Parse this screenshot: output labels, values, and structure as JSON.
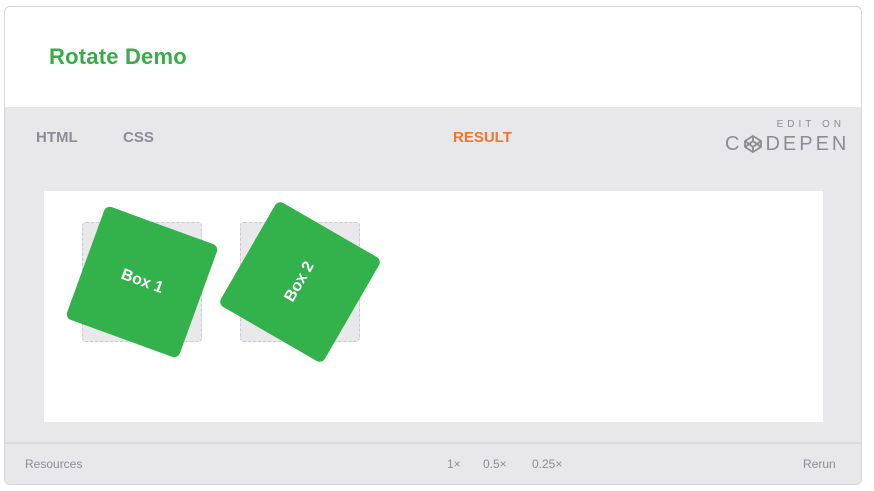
{
  "header": {
    "title": "Rotate Demo"
  },
  "tabs": [
    {
      "label": "HTML",
      "active": false
    },
    {
      "label": "CSS",
      "active": false
    },
    {
      "label": "RESULT",
      "active": true
    }
  ],
  "codepen": {
    "edit_on": "EDIT ON",
    "brand_left": "C",
    "brand_right": "DEPEN",
    "icon": "codepen-logo-icon"
  },
  "result": {
    "boxes": [
      {
        "label": "Box 1",
        "rotation_deg": 20
      },
      {
        "label": "Box 2",
        "rotation_deg": -60
      }
    ]
  },
  "footer": {
    "resources": "Resources",
    "zoom_options": [
      "1×",
      "0.5×",
      "0.25×"
    ],
    "rerun": "Rerun"
  },
  "colors": {
    "title": "#3bab4a",
    "active_tab": "#f0762c",
    "box": "#33b24c",
    "chrome": "#e8e8eb",
    "muted_text": "#8c8c96"
  }
}
